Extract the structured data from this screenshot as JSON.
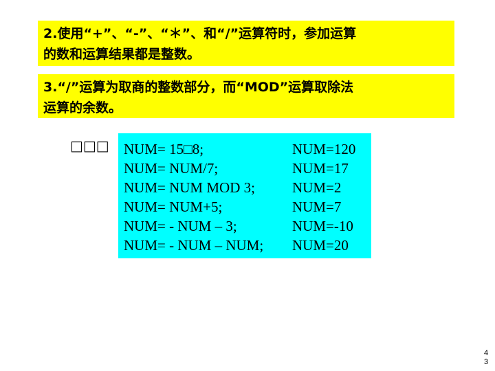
{
  "notes": [
    {
      "lines": [
        "2.使用“+”、“-”、“＊”、和“/”运算符时，参加运算",
        "的数和运算结果都是整数。"
      ]
    },
    {
      "lines": [
        "3.“/”运算为取商的整数部分，而“MOD”运算取除法",
        "运算的余数。"
      ]
    }
  ],
  "example_label": "□□□",
  "code_examples": [
    {
      "statement": "NUM= 15□8;",
      "result": "NUM=120"
    },
    {
      "statement": "NUM= NUM/7;",
      "result": "NUM=17"
    },
    {
      "statement": "NUM= NUM MOD 3;",
      "result": "NUM=2"
    },
    {
      "statement": "NUM= NUM+5;",
      "result": "NUM=7"
    },
    {
      "statement": "NUM= - NUM – 3;",
      "result": "NUM=-10"
    },
    {
      "statement": "NUM= - NUM – NUM;",
      "result": "NUM=20"
    }
  ],
  "page_number": [
    "4",
    "3"
  ],
  "colors": {
    "note_background": "#ffff00",
    "code_background": "#00ffff",
    "text": "#000000"
  }
}
